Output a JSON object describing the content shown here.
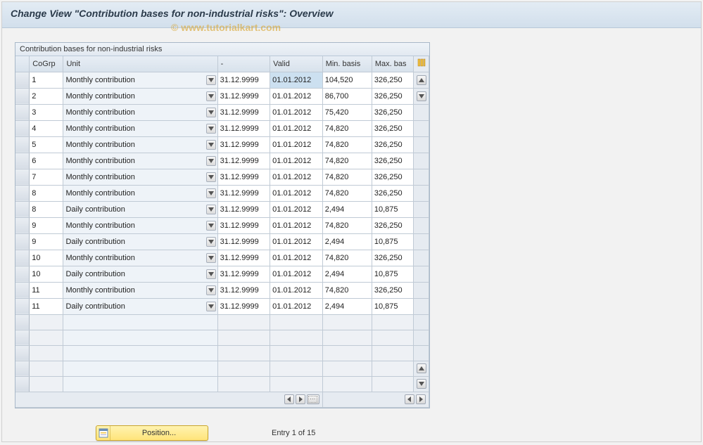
{
  "title": "Change View \"Contribution bases for non-industrial risks\": Overview",
  "watermark": "© www.tutorialkart.com",
  "panel_title": "Contribution bases for non-industrial risks",
  "columns": {
    "cogrp": "CoGrp",
    "unit": "Unit",
    "dash": "-",
    "valid": "Valid",
    "min": "Min. basis",
    "max": "Max. bas"
  },
  "rows": [
    {
      "cogrp": "1",
      "unit": "Monthly contribution",
      "dash": "31.12.9999",
      "valid": "01.01.2012",
      "min": "104,520",
      "max": "326,250",
      "selected_valid": true
    },
    {
      "cogrp": "2",
      "unit": "Monthly contribution",
      "dash": "31.12.9999",
      "valid": "01.01.2012",
      "min": "86,700",
      "max": "326,250"
    },
    {
      "cogrp": "3",
      "unit": "Monthly contribution",
      "dash": "31.12.9999",
      "valid": "01.01.2012",
      "min": "75,420",
      "max": "326,250"
    },
    {
      "cogrp": "4",
      "unit": "Monthly contribution",
      "dash": "31.12.9999",
      "valid": "01.01.2012",
      "min": "74,820",
      "max": "326,250"
    },
    {
      "cogrp": "5",
      "unit": "Monthly contribution",
      "dash": "31.12.9999",
      "valid": "01.01.2012",
      "min": "74,820",
      "max": "326,250"
    },
    {
      "cogrp": "6",
      "unit": "Monthly contribution",
      "dash": "31.12.9999",
      "valid": "01.01.2012",
      "min": "74,820",
      "max": "326,250"
    },
    {
      "cogrp": "7",
      "unit": "Monthly contribution",
      "dash": "31.12.9999",
      "valid": "01.01.2012",
      "min": "74,820",
      "max": "326,250"
    },
    {
      "cogrp": "8",
      "unit": "Monthly contribution",
      "dash": "31.12.9999",
      "valid": "01.01.2012",
      "min": "74,820",
      "max": "326,250"
    },
    {
      "cogrp": "8",
      "unit": "Daily contribution",
      "dash": "31.12.9999",
      "valid": "01.01.2012",
      "min": "2,494",
      "max": "10,875"
    },
    {
      "cogrp": "9",
      "unit": "Monthly contribution",
      "dash": "31.12.9999",
      "valid": "01.01.2012",
      "min": "74,820",
      "max": "326,250"
    },
    {
      "cogrp": "9",
      "unit": "Daily contribution",
      "dash": "31.12.9999",
      "valid": "01.01.2012",
      "min": "2,494",
      "max": "10,875"
    },
    {
      "cogrp": "10",
      "unit": "Monthly contribution",
      "dash": "31.12.9999",
      "valid": "01.01.2012",
      "min": "74,820",
      "max": "326,250"
    },
    {
      "cogrp": "10",
      "unit": "Daily contribution",
      "dash": "31.12.9999",
      "valid": "01.01.2012",
      "min": "2,494",
      "max": "10,875"
    },
    {
      "cogrp": "11",
      "unit": "Monthly contribution",
      "dash": "31.12.9999",
      "valid": "01.01.2012",
      "min": "74,820",
      "max": "326,250"
    },
    {
      "cogrp": "11",
      "unit": "Daily contribution",
      "dash": "31.12.9999",
      "valid": "01.01.2012",
      "min": "2,494",
      "max": "10,875"
    }
  ],
  "empty_rows": 5,
  "footer": {
    "position_label": "Position...",
    "entry_status": "Entry 1 of 15"
  }
}
